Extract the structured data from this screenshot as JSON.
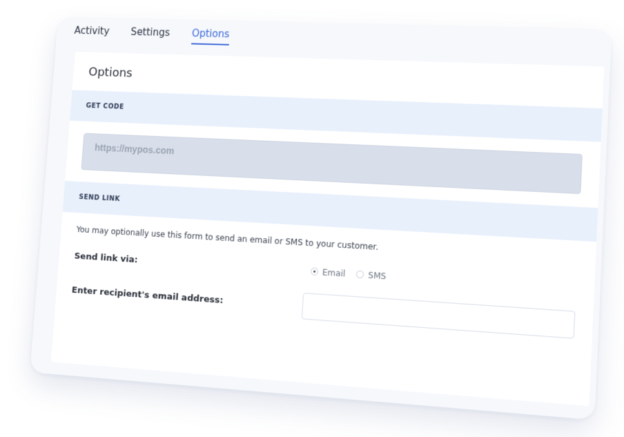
{
  "tabs": [
    {
      "label": "Activity"
    },
    {
      "label": "Settings"
    },
    {
      "label": "Options"
    }
  ],
  "panel": {
    "title": "Options",
    "get_code": {
      "heading": "GET CODE",
      "value": "https://mypos.com"
    },
    "send_link": {
      "heading": "SEND LINK",
      "description": "You may optionally use this form to send an email or SMS to your customer.",
      "via_label": "Send link via:",
      "options": [
        {
          "label": "Email",
          "selected": true
        },
        {
          "label": "SMS",
          "selected": false
        }
      ],
      "recipient_label": "Enter recipient's email address:",
      "recipient_value": "",
      "recipient_placeholder": ""
    }
  },
  "colors": {
    "accent": "#3a66d9",
    "section_bg": "#e8f0fc",
    "code_box_bg": "#d8dfea"
  }
}
